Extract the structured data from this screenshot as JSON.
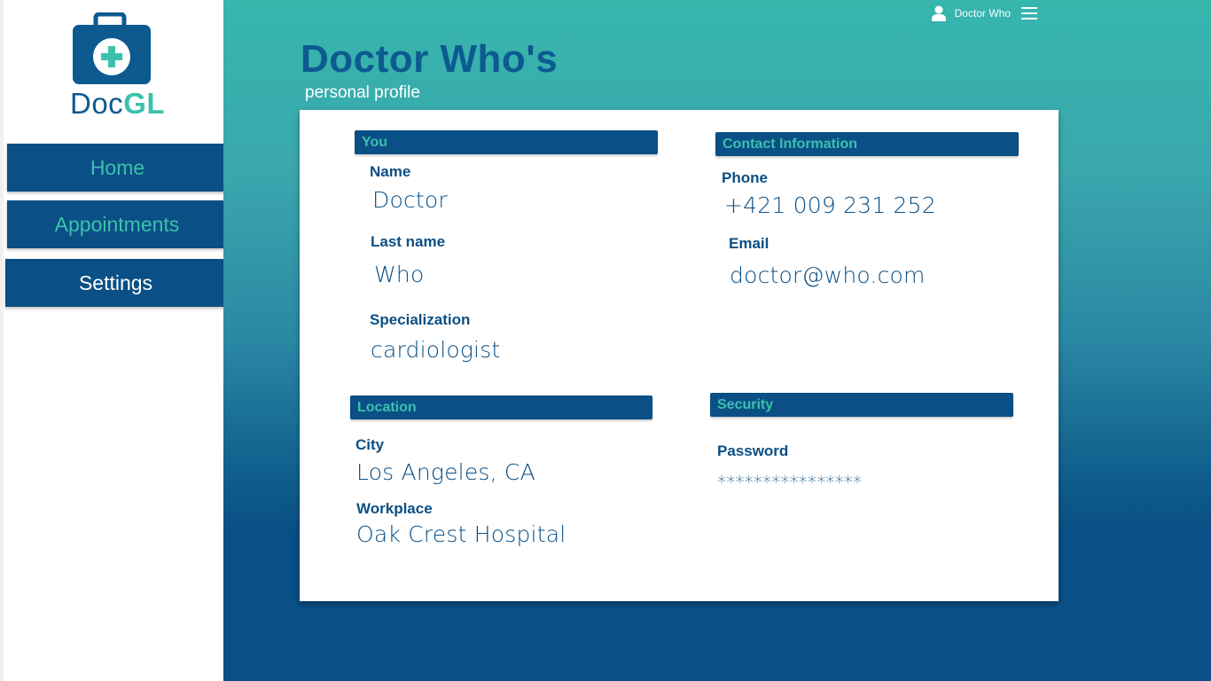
{
  "app": {
    "brand_part1": "Doc",
    "brand_part2": "GL",
    "brand_color": "#0c5a90",
    "accent_color": "#3cc1ad"
  },
  "sidebar": {
    "items": [
      {
        "label": "Home"
      },
      {
        "label": "Appointments"
      },
      {
        "label": "Settings"
      }
    ]
  },
  "topbar": {
    "user_name": "Doctor Who",
    "user_icon": "user-icon",
    "menu_icon": "hamburger-menu-icon"
  },
  "page": {
    "title": "Doctor Who's",
    "subtitle": "personal profile"
  },
  "sections": {
    "you": {
      "heading": "You",
      "name_label": "Name",
      "name_value": "Doctor",
      "lastname_label": "Last name",
      "lastname_value": "Who",
      "specialization_label": "Specialization",
      "specialization_value": "cardiologist"
    },
    "contact": {
      "heading": "Contact Information",
      "phone_label": "Phone",
      "phone_value": "+421 009 231 252",
      "email_label": "Email",
      "email_value": "doctor@who.com"
    },
    "location": {
      "heading": "Location",
      "city_label": "City",
      "city_value": "Los Angeles, CA",
      "workplace_label": "Workplace",
      "workplace_value": "Oak Crest Hospital"
    },
    "security": {
      "heading": "Security",
      "password_label": "Password",
      "password_value": "****************"
    }
  }
}
